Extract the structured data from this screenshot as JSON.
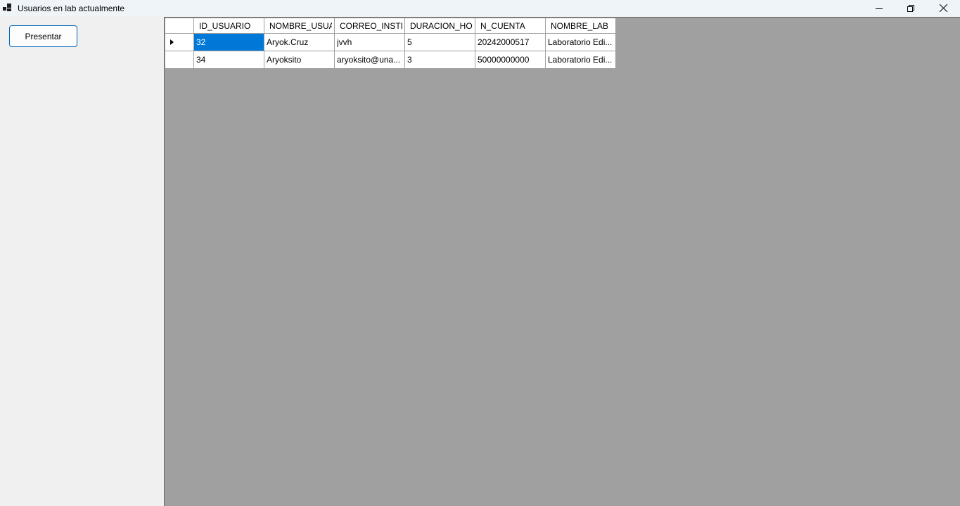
{
  "window": {
    "title": "Usuarios en lab actualmente"
  },
  "toolbar": {
    "present_label": "Presentar"
  },
  "grid": {
    "columns": [
      "ID_USUARIO",
      "NOMBRE_USUARIO",
      "CORREO_INSTITU",
      "DURACION_HOR",
      "N_CUENTA",
      "NOMBRE_LAB"
    ],
    "rows": [
      [
        "32",
        "Aryok.Cruz",
        "jvvh",
        "5",
        "20242000517",
        "Laboratorio Edi..."
      ],
      [
        "34",
        "Aryoksito",
        "aryoksito@una...",
        "3",
        "50000000000",
        "Laboratorio Edi..."
      ]
    ],
    "selected_row": 0,
    "selected_col": 0
  },
  "colors": {
    "selection": "#0078d7",
    "grid_background": "#a0a0a0",
    "button_border": "#0067c0"
  },
  "icons": {
    "app": "app-window-icon",
    "minimize": "minimize-icon",
    "restore": "restore-icon",
    "close": "close-icon",
    "row_indicator": "current-row-arrow-icon"
  }
}
